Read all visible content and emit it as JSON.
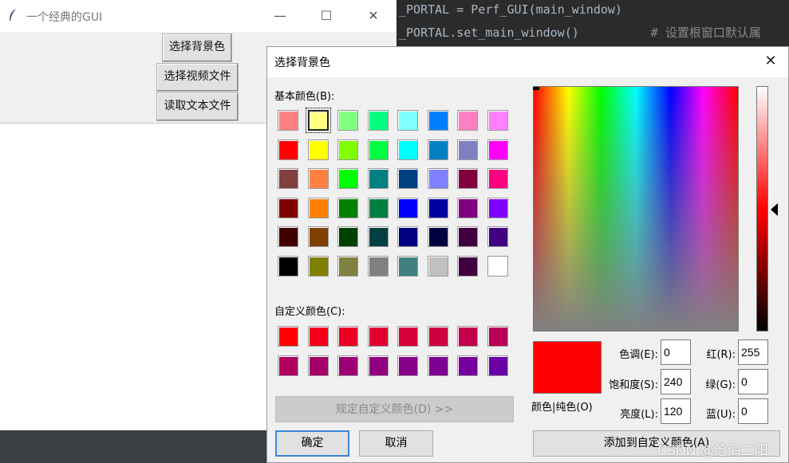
{
  "editor": {
    "line1": "_PORTAL = Perf_GUI(main_window)",
    "line2": "_PORTAL.set_main_window()",
    "comment2": "# 设置根窗口默认属"
  },
  "main_window": {
    "title": "一个经典的GUI",
    "icon": "feather-icon",
    "minimize": "—",
    "maximize": "☐",
    "close": "✕",
    "buttons": [
      "选择背景色",
      "选择视频文件",
      "读取文本文件"
    ]
  },
  "dialog": {
    "title": "选择背景色",
    "close": "✕",
    "basic_label": "基本颜色(B):",
    "custom_label": "自定义颜色(C):",
    "basic_colors": [
      [
        "#ff8080",
        "#ffff80",
        "#80ff80",
        "#00ff80",
        "#80ffff",
        "#0080ff",
        "#ff80c0",
        "#ff80ff"
      ],
      [
        "#ff0000",
        "#ffff00",
        "#80ff00",
        "#00ff40",
        "#00ffff",
        "#0080c0",
        "#8080c0",
        "#ff00ff"
      ],
      [
        "#804040",
        "#ff8040",
        "#00ff00",
        "#008080",
        "#004080",
        "#8080ff",
        "#800040",
        "#ff0080"
      ],
      [
        "#800000",
        "#ff8000",
        "#008000",
        "#008040",
        "#0000ff",
        "#0000a0",
        "#800080",
        "#8000ff"
      ],
      [
        "#400000",
        "#804000",
        "#004000",
        "#004040",
        "#000080",
        "#000040",
        "#400040",
        "#400080"
      ],
      [
        "#000000",
        "#808000",
        "#808040",
        "#808080",
        "#408080",
        "#c0c0c0",
        "#400040",
        "#ffffff"
      ]
    ],
    "selected_basic": "0,1",
    "custom_colors": [
      [
        "#ff0000",
        "#f5001a",
        "#eb0024",
        "#e1002e",
        "#d70038",
        "#cd0042",
        "#c3004c",
        "#b90056"
      ],
      [
        "#af0060",
        "#a5006a",
        "#9b0074",
        "#91007e",
        "#870088",
        "#7d0092",
        "#73009c",
        "#6900a6"
      ]
    ],
    "define_button": "规定自定义颜色(D) >>",
    "ok_button": "确定",
    "cancel_button": "取消",
    "preview_label": "颜色|纯色(O)",
    "preview_color": "#ff0000",
    "hue_label": "色调(E):",
    "hue_value": "0",
    "sat_label": "饱和度(S):",
    "sat_value": "240",
    "lum_label": "亮度(L):",
    "lum_value": "120",
    "red_label": "红(R):",
    "red_value": "255",
    "green_label": "绿(G):",
    "green_value": "0",
    "blue_label": "蓝(U):",
    "blue_value": "0",
    "add_button": "添加到自定义颜色(A)"
  },
  "watermark": "CSDN @沧海二阳"
}
